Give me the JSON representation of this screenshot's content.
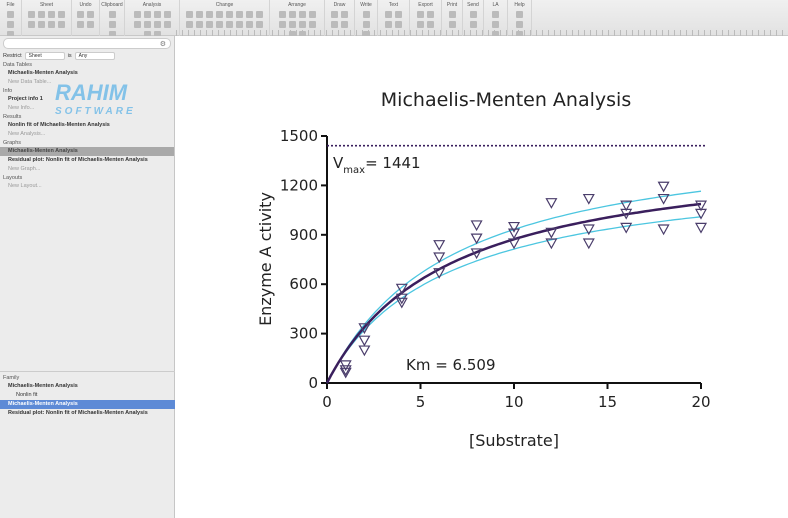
{
  "toolbar": {
    "groups": [
      "File",
      "Sheet",
      "Undo",
      "Clipboard",
      "Analysis",
      "Change",
      "Arrange",
      "Draw",
      "Write",
      "Text",
      "Export",
      "Print",
      "Send",
      "LA",
      "Help"
    ]
  },
  "sidebar": {
    "restrict_label": "Restrict",
    "restrict_value": "Sheet",
    "is_label": "is",
    "is_value": "Any",
    "sections": [
      {
        "title": "Data Tables",
        "items": [
          {
            "label": "Michaelis-Menten Analysis"
          },
          {
            "label": "New Data Table...",
            "new": true
          }
        ]
      },
      {
        "title": "Info",
        "items": [
          {
            "label": "Project info 1"
          },
          {
            "label": "New Info...",
            "new": true
          }
        ]
      },
      {
        "title": "Results",
        "items": [
          {
            "label": "Nonlin fit of Michaelis-Menten Analysis"
          },
          {
            "label": "New Analysis...",
            "new": true
          }
        ]
      },
      {
        "title": "Graphs",
        "items": [
          {
            "label": "Michaelis-Menten Analysis",
            "selected": true
          },
          {
            "label": "Residual plot: Nonlin fit of Michaelis-Menten Analysis"
          },
          {
            "label": "New Graph...",
            "new": true
          }
        ]
      },
      {
        "title": "Layouts",
        "items": [
          {
            "label": "New Layout...",
            "new": true
          }
        ]
      }
    ],
    "family": {
      "title": "Family",
      "items": [
        {
          "label": "Michaelis-Menten Analysis"
        },
        {
          "label": "Nonlin fit",
          "sub": true
        },
        {
          "label": "Michaelis-Menten Analysis",
          "selected": true
        },
        {
          "label": "Residual plot: Nonlin fit of Michaelis-Menten Analysis"
        }
      ]
    }
  },
  "watermark": {
    "line1": "RAHIM",
    "line2": "SOFTWARE"
  },
  "chart_data": {
    "type": "scatter",
    "title": "Michaelis-Menten Analysis",
    "xlabel": "[Substrate]",
    "ylabel": "Enzyme A ctivity",
    "xlim": [
      0,
      20
    ],
    "ylim": [
      0,
      1500
    ],
    "xticks": [
      0,
      5,
      10,
      15,
      20
    ],
    "yticks": [
      0,
      300,
      600,
      900,
      1200,
      1500
    ],
    "marker": "inverted-triangle",
    "x": [
      1,
      2,
      4,
      6,
      8,
      10,
      12,
      14,
      16,
      18,
      20
    ],
    "replicates": [
      [
        110,
        80,
        65
      ],
      [
        335,
        260,
        200
      ],
      [
        575,
        515,
        490
      ],
      [
        840,
        765,
        670
      ],
      [
        960,
        880,
        790
      ],
      [
        950,
        910,
        850
      ],
      [
        1095,
        915,
        850
      ],
      [
        1120,
        935,
        850
      ],
      [
        1080,
        1030,
        945
      ],
      [
        1195,
        1120,
        935
      ],
      [
        1080,
        1030,
        945
      ]
    ],
    "fit": {
      "model": "Michaelis-Menten",
      "Vmax": 1441,
      "Km": 6.509,
      "color": "#3a1f5d"
    },
    "band_color": "#4cc6e0",
    "annotations": {
      "vmax_label": "V",
      "vmax_sub": "max",
      "vmax_value": "= 1441",
      "km_label": "Km = 6.509"
    }
  }
}
